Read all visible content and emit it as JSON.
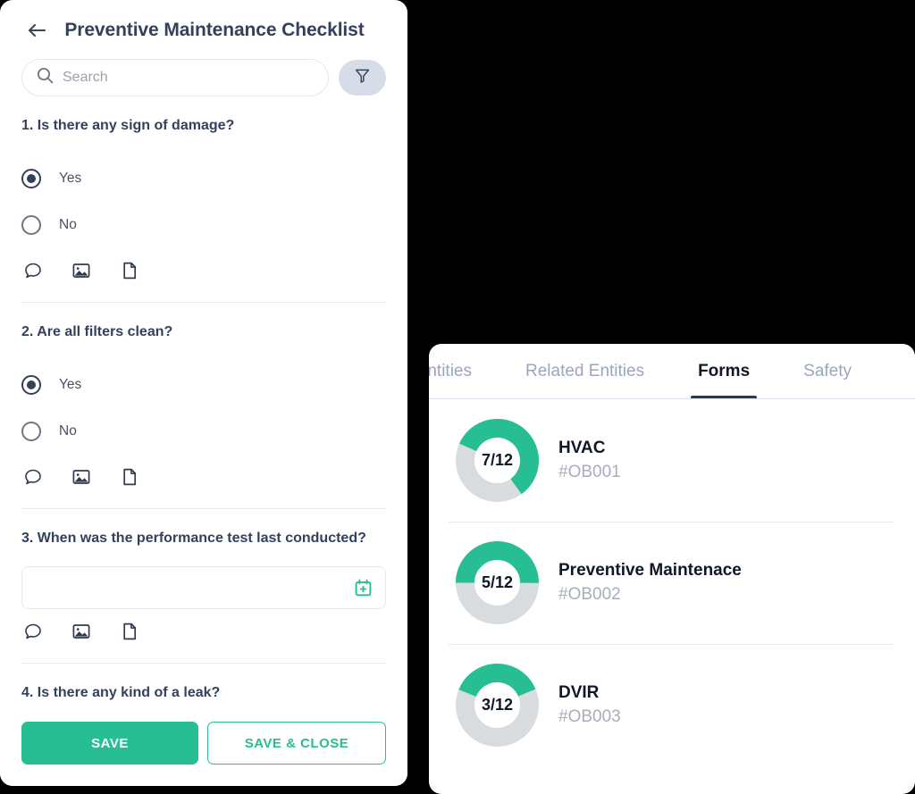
{
  "checklist": {
    "back_icon": "arrow-left-icon",
    "title": "Preventive Maintenance Checklist",
    "search": {
      "icon": "search-icon",
      "placeholder": "Search",
      "value": ""
    },
    "filter": {
      "icon": "filter-icon",
      "label": "Filter"
    },
    "attachment_icons": [
      "comment-icon",
      "image-icon",
      "document-icon"
    ],
    "questions": [
      {
        "text": "1. Is there any sign of damage?",
        "type": "radio",
        "options": [
          {
            "label": "Yes",
            "selected": true
          },
          {
            "label": "No",
            "selected": false
          }
        ]
      },
      {
        "text": "2. Are all filters clean?",
        "type": "radio",
        "options": [
          {
            "label": "Yes",
            "selected": true
          },
          {
            "label": "No",
            "selected": false
          }
        ]
      },
      {
        "text": "3. When was the performance test last conducted?",
        "type": "date",
        "value": "",
        "date_icon": "calendar-plus-icon"
      },
      {
        "text": "4. Is there any kind of a leak?",
        "type": "radio",
        "options": []
      }
    ],
    "actions": {
      "save_label": "SAVE",
      "save_close_label": "SAVE & CLOSE"
    }
  },
  "forms_panel": {
    "tabs": [
      {
        "label": "ted Entities",
        "active": false,
        "clipped": true
      },
      {
        "label": "Related Entities",
        "active": false
      },
      {
        "label": "Forms",
        "active": true
      },
      {
        "label": "Safety",
        "active": false
      }
    ],
    "forms": [
      {
        "name": "HVAC",
        "code": "#OB001",
        "completed": 7,
        "total": 12,
        "progress_label": "7/12"
      },
      {
        "name": "Preventive Maintenace",
        "code": "#OB002",
        "completed": 5,
        "total": 12,
        "progress_label": "5/12"
      },
      {
        "name": "DVIR",
        "code": "#OB003",
        "completed": 3,
        "total": 12,
        "progress_label": "3/12"
      }
    ]
  },
  "colors": {
    "accent_green": "#26BE92",
    "track_gray": "#D9DCDE",
    "text_dark": "#33415C",
    "text_muted": "#A6AEBC",
    "tab_inactive": "#9BA6BC",
    "filter_bg": "#D7DDE8",
    "background": "#000000"
  }
}
